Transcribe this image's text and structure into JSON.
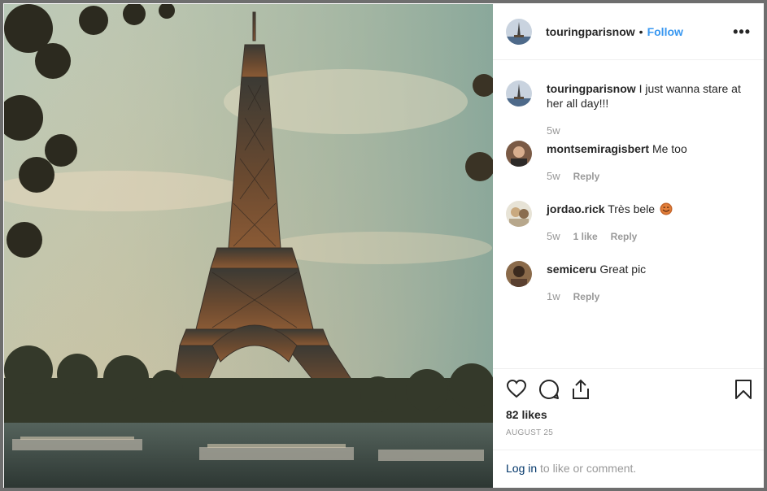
{
  "post": {
    "username": "touringparisnow",
    "follow_label": "Follow",
    "separator": "•",
    "more_label": "•••"
  },
  "comments": [
    {
      "user": "touringparisnow",
      "text": "I just wanna stare at her all day!!!",
      "time": "5w",
      "likes": "",
      "reply": ""
    },
    {
      "user": "montsemiragisbert",
      "text": "Me too",
      "time": "5w",
      "likes": "",
      "reply": "Reply"
    },
    {
      "user": "jordao.rick",
      "text": "Très bele",
      "time": "5w",
      "likes": "1 like",
      "reply": "Reply"
    },
    {
      "user": "semiceru",
      "text": "Great pic",
      "time": "1w",
      "likes": "",
      "reply": "Reply"
    }
  ],
  "footer": {
    "likes": "82 likes",
    "date": "AUGUST 25",
    "login_link": "Log in",
    "login_rest": " to like or comment."
  },
  "colors": {
    "link": "#3897f0",
    "muted": "#999999",
    "text": "#262626"
  },
  "icons": [
    "heart-icon",
    "comment-icon",
    "share-icon",
    "bookmark-icon",
    "more-icon",
    "emoji-icon"
  ]
}
